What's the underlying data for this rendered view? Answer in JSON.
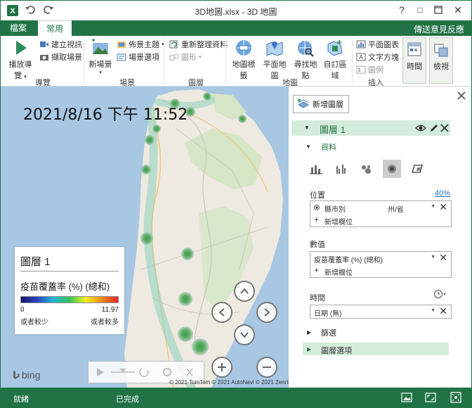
{
  "window": {
    "title": "3D地圖.xlsx - 3D 地圖",
    "help": "?",
    "restore": "□",
    "maximize": "□",
    "close": "✕"
  },
  "tabs": {
    "file": "檔案",
    "home": "常用"
  },
  "feedback": "傳送意見反應",
  "ribbon": {
    "tour": {
      "play": "播放導覽",
      "create_video": "建立視訊",
      "capture": "擷取場景",
      "label": "導覽"
    },
    "scene": {
      "new_scene": "新場景",
      "theme": "佈景主題",
      "options": "場景選項",
      "label": "場景"
    },
    "layer": {
      "refresh": "重新整理資料",
      "shapes": "圖形",
      "label": "圖層"
    },
    "map": {
      "labels": "地圖標籤",
      "flat": "平面地圖",
      "find": "尋找地點",
      "custom": "自訂區域",
      "label": "地圖"
    },
    "insert": {
      "2d_chart": "平面圖表",
      "textbox": "文字方塊",
      "legend": "圖例",
      "label": "插入"
    },
    "time": "時間",
    "view": "檢視"
  },
  "map": {
    "datetime": "2021/8/16 下午 11:52",
    "copyright": "© 2021 TomTom  © 2021 AutoNavi  © 2021 Zenrin",
    "bing": "bing"
  },
  "legend": {
    "title": "圖層 1",
    "field": "疫苗覆蓋率 (%) (總和)",
    "min": "0",
    "max": "11.97",
    "low_label": "或者較少",
    "high_label": "或者較多"
  },
  "panel": {
    "add_layer": "新增圖層",
    "layer_name": "圖層 1",
    "data_section": "資料",
    "location_label": "位置",
    "location_pct": "40%",
    "location_field": "縣市別",
    "location_type": "州/省",
    "add_field": "新增欄位",
    "value_label": "數值",
    "value_field": "疫苗覆蓋率 (%) (總和)",
    "time_label": "時間",
    "time_field": "日期 (無)",
    "filter": "篩選",
    "layer_options": "圖層選項"
  },
  "status": {
    "ready": "就緒",
    "done": "已完成"
  },
  "colors": {
    "accent": "#217346",
    "layer_band": "#d4ecdc"
  }
}
